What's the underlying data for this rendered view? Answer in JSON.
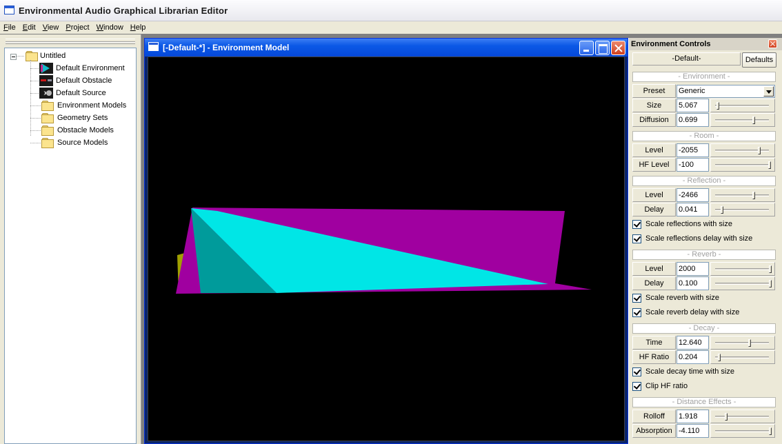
{
  "app": {
    "title": "Environmental Audio Graphical Librarian Editor"
  },
  "menu": [
    {
      "label": "File",
      "acc": "F",
      "rest": "ile"
    },
    {
      "label": "Edit",
      "acc": "E",
      "rest": "dit"
    },
    {
      "label": "View",
      "acc": "V",
      "rest": "iew"
    },
    {
      "label": "Project",
      "acc": "P",
      "rest": "roject"
    },
    {
      "label": "Window",
      "acc": "W",
      "rest": "indow"
    },
    {
      "label": "Help",
      "acc": "H",
      "rest": "elp"
    }
  ],
  "tree": {
    "root": "Untitled",
    "items": [
      {
        "label": "Default Environment",
        "icon": "environment-icon"
      },
      {
        "label": "Default Obstacle",
        "icon": "obstacle-icon"
      },
      {
        "label": "Default Source",
        "icon": "source-icon"
      },
      {
        "label": "Environment Models",
        "icon": "folder-icon"
      },
      {
        "label": "Geometry Sets",
        "icon": "folder-icon"
      },
      {
        "label": "Obstacle Models",
        "icon": "folder-icon"
      },
      {
        "label": "Source Models",
        "icon": "folder-icon"
      }
    ]
  },
  "child_window": {
    "title": "[-Default-*] - Environment Model"
  },
  "colors": {
    "cyan": "#00e6e6",
    "teal": "#009b9b",
    "magenta": "#a000a0",
    "olive": "#a0a000",
    "background": "#000000"
  },
  "controls": {
    "title": "Environment Controls",
    "name": "-Default-",
    "defaults_label": "Defaults",
    "sections": {
      "environment": "- Environment -",
      "room": "- Room -",
      "reflection": "- Reflection -",
      "reverb": "- Reverb -",
      "decay": "- Decay -",
      "distance": "- Distance Effects -"
    },
    "preset": {
      "label": "Preset",
      "value": "Generic"
    },
    "rows": {
      "size": {
        "label": "Size",
        "value": "5.067",
        "level": 0.05
      },
      "diffusion": {
        "label": "Diffusion",
        "value": "0.699",
        "level": 0.7
      },
      "room_level": {
        "label": "Level",
        "value": "-2055",
        "level": 0.8
      },
      "room_hf": {
        "label": "HF Level",
        "value": "-100",
        "level": 0.99
      },
      "refl_level": {
        "label": "Level",
        "value": "-2466",
        "level": 0.7
      },
      "refl_delay": {
        "label": "Delay",
        "value": "0.041",
        "level": 0.13
      },
      "reverb_level": {
        "label": "Level",
        "value": "2000",
        "level": 1.0
      },
      "reverb_delay": {
        "label": "Delay",
        "value": "0.100",
        "level": 1.0
      },
      "decay_time": {
        "label": "Time",
        "value": "12.640",
        "level": 0.63
      },
      "decay_hf": {
        "label": "HF Ratio",
        "value": "0.204",
        "level": 0.08
      },
      "rolloff": {
        "label": "Rolloff",
        "value": "1.918",
        "level": 0.2
      },
      "absorption": {
        "label": "Absorption",
        "value": "-4.110",
        "level": 1.0
      }
    },
    "checks": {
      "scale_refl": "Scale reflections with size",
      "scale_refl_delay": "Scale reflections delay with size",
      "scale_reverb": "Scale reverb with size",
      "scale_reverb_delay": "Scale reverb delay with size",
      "scale_decay": "Scale decay time with size",
      "clip_hf": "Clip HF ratio"
    }
  }
}
